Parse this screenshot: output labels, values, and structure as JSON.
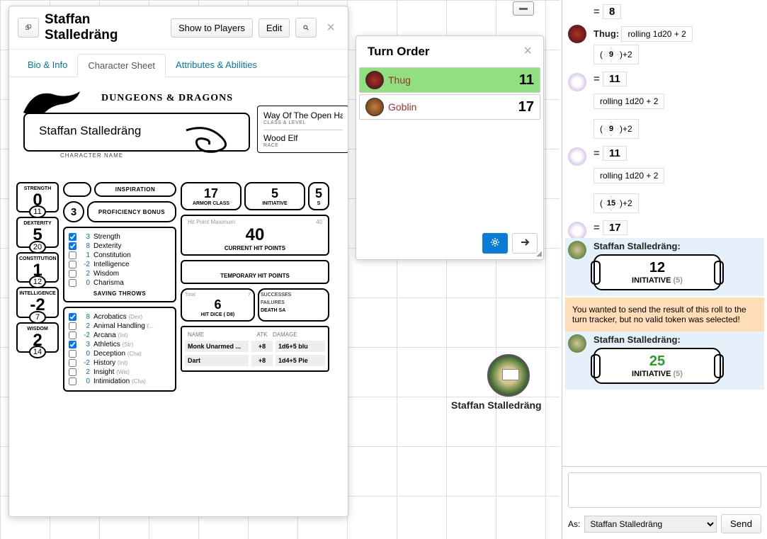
{
  "char_dialog": {
    "title": "Staffan Stalledräng",
    "show_players": "Show to Players",
    "edit": "Edit",
    "tabs": [
      "Bio & Info",
      "Character Sheet",
      "Attributes & Abilities"
    ],
    "logo": "DUNGEONS & DRAGONS",
    "charname": "Staffan Stalledräng",
    "charname_lbl": "CHARACTER NAME",
    "class_level": "Way Of The Open Ha",
    "class_level_lbl": "CLASS & LEVEL",
    "race": "Wood Elf",
    "race_lbl": "RACE",
    "inspiration_lbl": "INSPIRATION",
    "prof_bonus": "3",
    "prof_bonus_lbl": "PROFICIENCY BONUS",
    "abilities": [
      {
        "nm": "STRENGTH",
        "mod": "0",
        "score": "11"
      },
      {
        "nm": "DEXTERITY",
        "mod": "5",
        "score": "20"
      },
      {
        "nm": "CONSTITUTION",
        "mod": "1",
        "score": "12"
      },
      {
        "nm": "INTELLIGENCE",
        "mod": "-2",
        "score": "7"
      },
      {
        "nm": "WISDOM",
        "mod": "2",
        "score": "14"
      }
    ],
    "saves": [
      {
        "prof": true,
        "val": "3",
        "nm": "Strength"
      },
      {
        "prof": true,
        "val": "8",
        "nm": "Dexterity"
      },
      {
        "prof": false,
        "val": "1",
        "nm": "Constitution"
      },
      {
        "prof": false,
        "val": "-2",
        "nm": "Intelligence"
      },
      {
        "prof": false,
        "val": "2",
        "nm": "Wisdom"
      },
      {
        "prof": false,
        "val": "0",
        "nm": "Charisma"
      }
    ],
    "saves_lbl": "SAVING THROWS",
    "skills": [
      {
        "prof": true,
        "val": "8",
        "nm": "Acrobatics",
        "ab": "(Dex)"
      },
      {
        "prof": false,
        "val": "2",
        "nm": "Animal Handling",
        "ab": "(..."
      },
      {
        "prof": false,
        "val": "-2",
        "nm": "Arcana",
        "ab": "(Int)"
      },
      {
        "prof": true,
        "val": "3",
        "nm": "Athletics",
        "ab": "(Str)"
      },
      {
        "prof": false,
        "val": "0",
        "nm": "Deception",
        "ab": "(Cha)"
      },
      {
        "prof": false,
        "val": "-2",
        "nm": "History",
        "ab": "(Int)"
      },
      {
        "prof": false,
        "val": "2",
        "nm": "Insight",
        "ab": "(Wis)"
      },
      {
        "prof": false,
        "val": "0",
        "nm": "Intimidation",
        "ab": "(Cha)"
      }
    ],
    "ac": "17",
    "ac_lbl": "ARMOR CLASS",
    "init": "5",
    "init_lbl": "INITIATIVE",
    "speed": "5",
    "speed_lbl": "S",
    "hp_max_lbl": "Hit Point Maximum",
    "hp_max": "40",
    "hp_cur": "40",
    "hp_cur_lbl": "CURRENT HIT POINTS",
    "thp_lbl": "TEMPORARY HIT POINTS",
    "hd_total_lbl": "Total",
    "hd_total": "7",
    "hd_cur": "6",
    "hd_lbl": "HIT DICE",
    "hd_die": "( D8)",
    "success_lbl": "SUCCESSES",
    "fail_lbl": "FAILURES",
    "death_lbl": "DEATH SA",
    "atk_head": {
      "n": "NAME",
      "a": "ATK",
      "d": "DAMAGE"
    },
    "attacks": [
      {
        "n": "Monk Unarmed ...",
        "a": "+8",
        "d": "1d6+5 blu"
      },
      {
        "n": "Dart",
        "a": "+8",
        "d": "1d4+5 Pie"
      }
    ]
  },
  "turn_order": {
    "title": "Turn Order",
    "items": [
      {
        "nm": "Thug",
        "val": "11",
        "active": true,
        "color": "radial-gradient(#b03030,#401010)"
      },
      {
        "nm": "Goblin",
        "val": "17",
        "active": false,
        "color": "radial-gradient(#c08040,#603010)"
      }
    ]
  },
  "map_token": "Staffan Stalledräng",
  "chat": {
    "messages": [
      {
        "type": "eq",
        "res": "8"
      },
      {
        "type": "roll",
        "who": "Thug:",
        "avatar": "radial-gradient(#b03030,#401010)",
        "formula": "rolling 1d20 + 2",
        "dice": "9",
        "mod": "+2"
      },
      {
        "type": "eq",
        "res": "11",
        "avatar": "flower"
      },
      {
        "type": "formula",
        "formula": "rolling 1d20 + 2"
      },
      {
        "type": "dice",
        "dice": "9",
        "mod": "+2"
      },
      {
        "type": "eq",
        "res": "11",
        "avatar": "flower"
      },
      {
        "type": "formula",
        "formula": "rolling 1d20 + 2"
      },
      {
        "type": "dice",
        "dice": "15",
        "mod": "+2"
      },
      {
        "type": "eq",
        "res": "17",
        "avatar": "flower"
      },
      {
        "type": "init",
        "who": "Staffan Stalledräng:",
        "val": "12",
        "lbl": "INITIATIVE",
        "sub": "(5)",
        "green": false
      },
      {
        "type": "warn",
        "text": "You wanted to send the result of this roll to the turn tracker, but no valid token was selected!"
      },
      {
        "type": "init",
        "who": "Staffan Stalledräng:",
        "val": "25",
        "lbl": "INITIATIVE",
        "sub": "(5)",
        "green": true
      }
    ],
    "as_lbl": "As:",
    "as_value": "Staffan Stalledräng",
    "send": "Send"
  }
}
